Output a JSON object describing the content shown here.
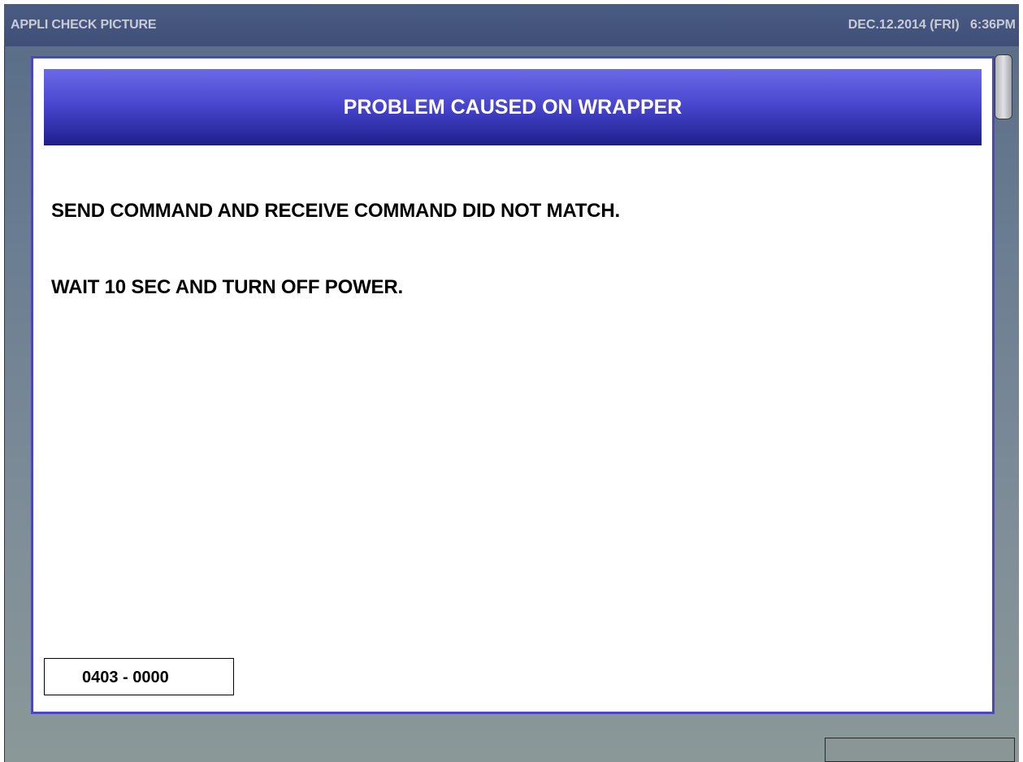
{
  "titlebar": {
    "screen_name": "APPLI CHECK PICTURE",
    "datetime": "DEC.12.2014 (FRI)   6:36PM"
  },
  "dialog": {
    "title": "PROBLEM CAUSED ON WRAPPER",
    "message_line1": "SEND COMMAND AND RECEIVE COMMAND DID NOT MATCH.",
    "message_line2": "WAIT 10 SEC AND TURN OFF POWER.",
    "error_code": "0403 - 0000"
  },
  "colors": {
    "dialog_border": "#4a48c0",
    "header_top": "#6a6ae8",
    "header_bottom": "#1e1e8a",
    "titlebar": "#4a5b84"
  }
}
